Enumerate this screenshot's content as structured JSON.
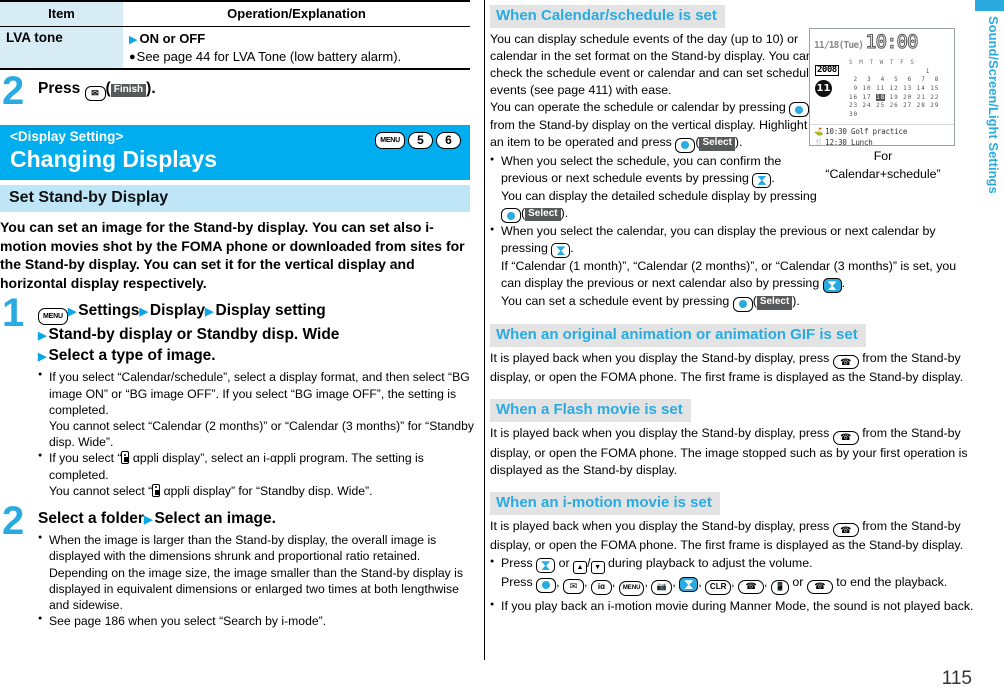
{
  "table": {
    "headers": [
      "Item",
      "Operation/Explanation"
    ],
    "rows": [
      {
        "item": "LVA tone",
        "op_main": "ON or OFF",
        "op_note": "See page 44 for LVA Tone (low battery alarm)."
      }
    ]
  },
  "step_top": {
    "num": "2",
    "text_before": "Press",
    "soft_label": "Finish",
    "text_after": ")."
  },
  "band": {
    "subtitle": "<Display Setting>",
    "title": "Changing Displays",
    "keys": [
      "MENU",
      "5",
      "6"
    ]
  },
  "section": {
    "title": "Set Stand-by Display",
    "intro": "You can set an image for the Stand-by display. You can set also i-motion movies shot by the FOMA phone or downloaded from sites for the Stand-by display. You can set it for the vertical display and horizontal display respectively."
  },
  "step1": {
    "num": "1",
    "menu_key": "MENU",
    "line1_a": "Settings",
    "line1_b": "Display",
    "line1_c": "Display setting",
    "line2": "Stand-by display or Standby disp. Wide",
    "line3": "Select a type of image.",
    "notes": [
      {
        "text": "If you select “Calendar/schedule”, select a display format, and then select “BG image ON” or “BG image OFF”. If you select “BG image OFF”, the setting is completed.",
        "cont": "You cannot select “Calendar (2 months)” or “Calendar (3 months)” for “Standby disp. Wide”."
      },
      {
        "text_pre": "If you select “",
        "text_mid": " αppli display”, select an i-αppli program. The setting is completed.",
        "cont_pre": "You cannot select “",
        "cont_post": " αppli display” for “Standby disp. Wide”."
      }
    ]
  },
  "step2": {
    "num": "2",
    "head_a": "Select a folder",
    "head_b": "Select an image.",
    "notes": [
      "When the image is larger than the Stand-by display, the overall image is displayed with the dimensions shrunk and proportional ratio retained. Depending on the image size, the image smaller than the Stand-by display is displayed in equivalent dimensions or enlarged two times at both lengthwise and sidewise.",
      "See page 186 when you select “Search by i-mode”."
    ]
  },
  "right": {
    "calendar_section": {
      "title": "When Calendar/schedule is set",
      "p1": "You can display schedule events of the day (up to 10) or calendar in the set format on the Stand-by display. You can check the schedule event or calendar and can set schedule events (see page 411) with ease.",
      "p2_a": "You can operate the schedule or calendar by pressing",
      "p2_b": "from the Stand-by display on the vertical display. Highlight an item to be operated and press",
      "p2_soft": "Select",
      "p2_c": ").",
      "notes": [
        {
          "a": "When you select the schedule, you can confirm the previous or next schedule events by pressing",
          "b": ".",
          "c": "You can display the detailed schedule display by pressing",
          "soft": "Select",
          "d": ")."
        },
        {
          "a": "When you select the calendar, you can display the previous or next calendar by pressing",
          "b": ".",
          "c": "If “Calendar (1 month)”, “Calendar (2 months)”, or “Calendar (3 months)” is set, you can display the previous or next calendar also by pressing",
          "d": ".",
          "e": "You can set a schedule event by pressing",
          "soft": "Select",
          "f": ")."
        }
      ]
    },
    "figure": {
      "date": "11/18(Tue)",
      "clock": "10:00",
      "year": "2008",
      "month": "11",
      "dow": [
        "S",
        "M",
        "T",
        "W",
        "T",
        "F",
        "S"
      ],
      "weeks": [
        "           1",
        " 2  3  4  5  6  7  8",
        " 9 10 11 12 13 14 15",
        "16 17 18 19 20 21 22",
        "23 24 25 26 27 28 29",
        "30"
      ],
      "events": [
        {
          "icon": "⛳",
          "time": "10:30",
          "title": "Golf practice"
        },
        {
          "icon": "🍴",
          "time": "12:30",
          "title": "Lunch"
        }
      ],
      "caption_line1": "For",
      "caption_line2": "“Calendar+schedule”"
    },
    "animation_section": {
      "title": "When an original animation or animation GIF is set",
      "a": "It is played back when you display the Stand-by display, press",
      "b": "from the Stand-by display, or open the FOMA phone. The first frame is displayed as the Stand-by display."
    },
    "flash_section": {
      "title": "When a Flash movie is set",
      "a": "It is played back when you display the Stand-by display, press",
      "b": "from the Stand-by display, or open the FOMA phone. The image stopped such as by your first operation is displayed as the Stand-by display."
    },
    "imotion_section": {
      "title": "When an i-motion movie is set",
      "a": "It is played back when you display the Stand-by display, press",
      "b": "from the Stand-by display, or open the FOMA phone. The first frame is displayed as the Stand-by display.",
      "note1_a": "Press",
      "note1_b": "or",
      "note1_c": "during playback to adjust the volume.",
      "note1_d": "Press",
      "note1_e": "or",
      "note1_f": "to end the playback.",
      "note2": "If you play back an i-motion movie during Manner Mode, the sound is not played back."
    }
  },
  "side_tab": {
    "label": "Sound/Screen/Light Settings"
  },
  "page_number": "115",
  "colors": {
    "accent_blue": "#00aeef",
    "light_blue": "#bfe6f7",
    "table_blue": "#d8ecf5",
    "sub_bar_gray": "#e3e3e3",
    "sub_bar_text": "#29abe2"
  }
}
